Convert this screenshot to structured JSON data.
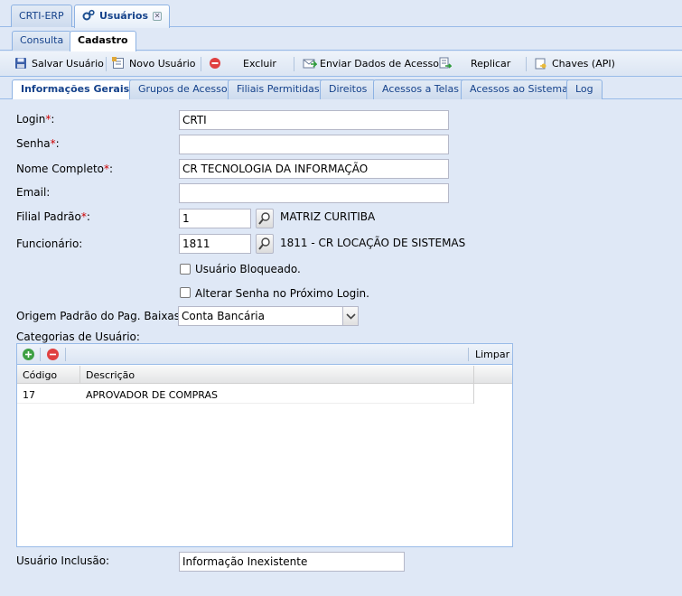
{
  "window_tabs": [
    {
      "label": "CRTI-ERP",
      "icon": "none"
    },
    {
      "label": "Usuários",
      "icon": "gears-icon"
    }
  ],
  "sub_tabs": [
    "Consulta",
    "Cadastro"
  ],
  "toolbar": {
    "save": "Salvar Usuário",
    "new": "Novo Usuário",
    "delete": "Excluir",
    "send_access": "Enviar Dados de Acesso",
    "replicate": "Replicar",
    "keys": "Chaves (API)"
  },
  "inner_tabs": [
    "Informações Gerais",
    "Grupos de Acesso",
    "Filiais Permitidas",
    "Direitos",
    "Acessos a Telas",
    "Acessos ao Sistema",
    "Log"
  ],
  "form": {
    "login_label": "Login",
    "login_value": "CRTI",
    "senha_label": "Senha",
    "senha_value": "",
    "nome_label": "Nome Completo",
    "nome_value": "CR TECNOLOGIA DA INFORMAÇÃO",
    "email_label": "Email:",
    "email_value": "",
    "filial_label": "Filial Padrão",
    "filial_value": "1",
    "filial_desc": "MATRIZ CURITIBA",
    "func_label": "Funcionário:",
    "func_value": "1811",
    "func_desc": "1811 - CR LOCAÇÃO DE SISTEMAS",
    "bloqueado_label": "Usuário Bloqueado.",
    "alterar_senha_label": "Alterar Senha no Próximo Login.",
    "origem_label": "Origem Padrão do Pag. Baixas:",
    "origem_value": "Conta Bancária",
    "categorias_label": "Categorias de Usuário:",
    "inclusao_label": "Usuário Inclusão:",
    "inclusao_value": "Informação Inexistente"
  },
  "grid": {
    "clear_label": "Limpar",
    "columns": [
      "Código",
      "Descrição"
    ],
    "rows": [
      {
        "codigo": "17",
        "descricao": "APROVADOR DE COMPRAS"
      }
    ]
  },
  "colors": {
    "accent": "#15428b",
    "required": "#cc0000",
    "panel_bg": "#dfe8f6"
  }
}
